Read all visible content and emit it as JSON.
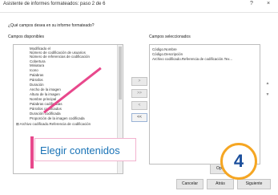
{
  "window": {
    "title": "Asistente de informes formateados: paso 2 de 6",
    "help_label": "?",
    "close_label": "×"
  },
  "prompt": "¿Qué campos desea en su informe formateado?",
  "available": {
    "label": "Campos disponibles",
    "items": [
      "Modificado el",
      "Número de codificación de usuarios",
      "Número de referencias de codificación",
      "Cobertura",
      "Miniatura",
      "Icono",
      "Palabras",
      "Párrafos",
      "Duración",
      "Ancho de la imagen",
      "Altura de la imagen",
      "Nombre principal",
      "Palabras codificadas",
      "Párrafos codificados",
      "Duración codificada",
      "Proporción de la imagen codificada",
      "Archivo codificado.Referencia de codificación"
    ]
  },
  "selected": {
    "label": "Campos seleccionados",
    "items": [
      "Código.Nombre",
      "Código.Descripción",
      "Archivo codificado.Referencia de codificación.Tex..."
    ]
  },
  "move": {
    "add": ">",
    "add_all": ">>",
    "remove": "<",
    "remove_all": "<<"
  },
  "order": {
    "up": "▲",
    "down": "▼"
  },
  "footer": {
    "options_label": "Opciones",
    "cancel_label": "Cancelar",
    "back_label": "Atrás",
    "next_label": "Siguiente"
  },
  "annotation": {
    "callout_text": "Elegir contenidos",
    "step_number": "4",
    "accent_color": "#e8488c",
    "badge_color": "#f5a623"
  }
}
